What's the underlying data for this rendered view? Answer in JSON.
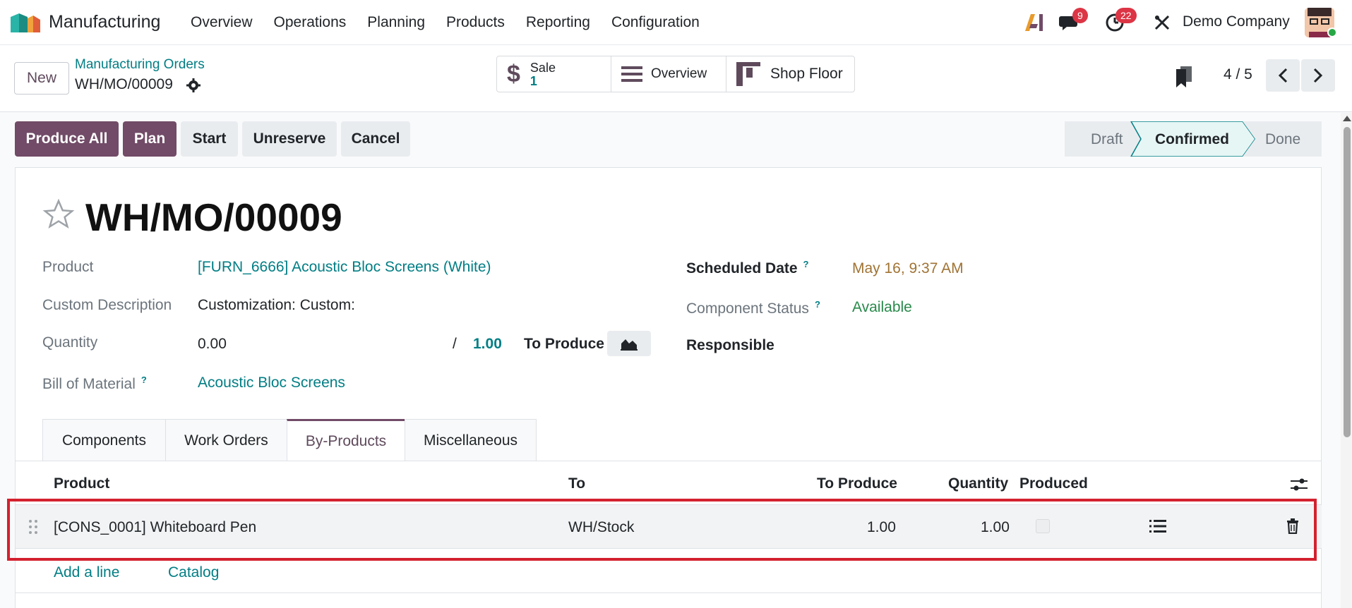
{
  "navbar": {
    "app_name": "Manufacturing",
    "menu": [
      "Overview",
      "Operations",
      "Planning",
      "Products",
      "Reporting",
      "Configuration"
    ],
    "chat_badge": "9",
    "activity_badge": "22",
    "company": "Demo Company"
  },
  "control": {
    "new_label": "New",
    "breadcrumb_parent": "Manufacturing Orders",
    "breadcrumb_current": "WH/MO/00009",
    "smart_sale_label": "Sale",
    "smart_sale_count": "1",
    "smart_overview": "Overview",
    "smart_shopfloor": "Shop Floor",
    "pager": "4 / 5"
  },
  "statusbar": {
    "produce_all": "Produce All",
    "plan": "Plan",
    "start": "Start",
    "unreserve": "Unreserve",
    "cancel": "Cancel",
    "stages": [
      "Draft",
      "Confirmed",
      "Done"
    ],
    "active_stage": "Confirmed"
  },
  "form": {
    "title": "WH/MO/00009",
    "product_label": "Product",
    "product_value": "[FURN_6666] Acoustic Bloc Screens (White)",
    "desc_label": "Custom Description",
    "desc_value": "Customization: Custom:",
    "qty_label": "Quantity",
    "qty_value": "0.00",
    "qty_sep": "/",
    "qty_target": "1.00",
    "to_produce": "To Produce",
    "bom_label": "Bill of Material",
    "bom_value": "Acoustic Bloc Screens",
    "sched_label": "Scheduled Date",
    "sched_value": "May 16, 9:37 AM",
    "comp_label": "Component Status",
    "comp_value": "Available",
    "resp_label": "Responsible",
    "qmark": "?"
  },
  "tabs": [
    "Components",
    "Work Orders",
    "By-Products",
    "Miscellaneous"
  ],
  "table": {
    "headers": {
      "product": "Product",
      "to": "To",
      "to_produce": "To Produce",
      "quantity": "Quantity",
      "produced": "Produced"
    },
    "rows": [
      {
        "product": "[CONS_0001] Whiteboard Pen",
        "to": "WH/Stock",
        "to_produce": "1.00",
        "quantity": "1.00"
      }
    ],
    "add_line": "Add a line",
    "catalog": "Catalog"
  },
  "colors": {
    "brand": "#714b67",
    "link": "#017e84",
    "highlight": "#d4212f"
  }
}
